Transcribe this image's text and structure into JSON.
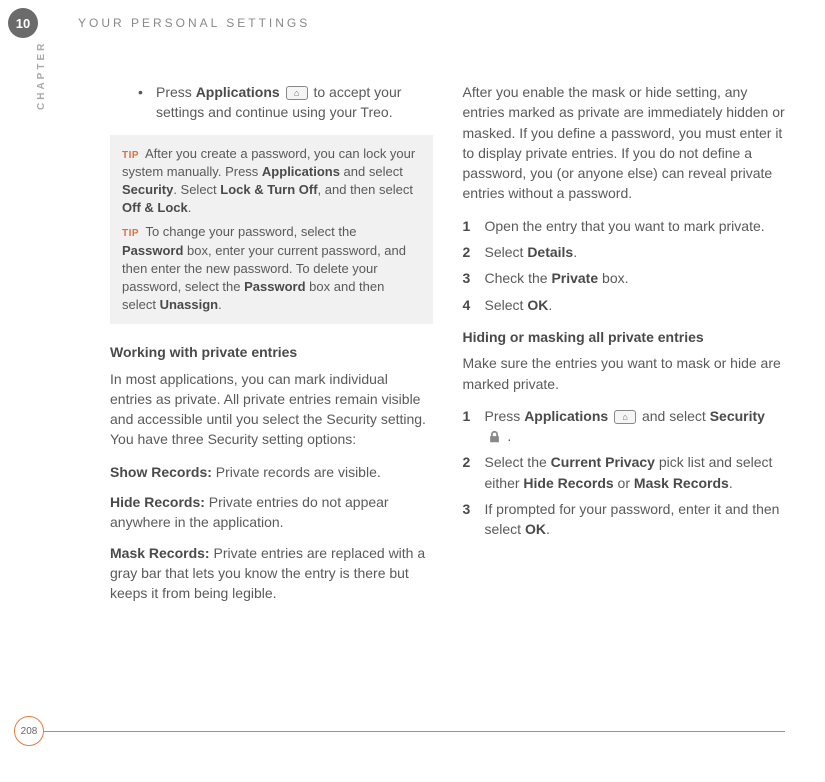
{
  "chapter": {
    "number": "10",
    "label": "CHAPTER",
    "title": "YOUR PERSONAL SETTINGS"
  },
  "page": {
    "number": "208"
  },
  "left": {
    "bullet": {
      "pre": "Press ",
      "b1": "Applications",
      "post": " to accept your settings and continue using your Treo."
    },
    "tip1": {
      "label": "TIP",
      "t1": "After you create a password, you can lock your system manually. Press ",
      "b1": "Applications",
      "t2": " and select ",
      "b2": "Security",
      "t3": ". Select ",
      "b3": "Lock & Turn Off",
      "t4": ", and then select ",
      "b4": "Off & Lock",
      "t5": "."
    },
    "tip2": {
      "label": "TIP",
      "t1": "To change your password, select the ",
      "b1": "Password",
      "t2": " box, enter your current password, and then enter the new password. To delete your password, select the ",
      "b2": "Password",
      "t3": " box and then select ",
      "b3": "Unassign",
      "t4": "."
    },
    "h1": "Working with private entries",
    "p1": "In most applications, you can mark individual entries as private. All private entries remain visible and accessible until you select the Security setting. You have three Security setting options:",
    "d1": {
      "b": "Show Records:",
      "t": " Private records are visible."
    },
    "d2": {
      "b": "Hide Records:",
      "t": " Private entries do not appear anywhere in the application."
    },
    "d3": {
      "b": "Mask Records:",
      "t": " Private entries are replaced with a gray bar that lets you know the entry is there but keeps it from being legible."
    }
  },
  "right": {
    "intro": "After you enable the mask or hide setting, any entries marked as private are immediately hidden or masked. If you define a password, you must enter it to display private entries. If you do not define a password, you (or anyone else) can reveal private entries without a password.",
    "listA": {
      "i1": "Open the entry that you want to mark private.",
      "i2": {
        "t1": "Select ",
        "b1": "Details",
        "t2": "."
      },
      "i3": {
        "t1": "Check the ",
        "b1": "Private",
        "t2": " box."
      },
      "i4": {
        "t1": "Select ",
        "b1": "OK",
        "t2": "."
      }
    },
    "h2": "Hiding or masking all private entries",
    "p2": "Make sure the entries you want to mask or hide are marked private.",
    "listB": {
      "i1": {
        "t1": "Press ",
        "b1": "Applications",
        "t2": " and select ",
        "b2": "Security",
        "t3": " ."
      },
      "i2": {
        "t1": "Select the ",
        "b1": "Current Privacy",
        "t2": " pick list and select either ",
        "b2": "Hide Records",
        "t3": " or ",
        "b3": "Mask Records",
        "t4": "."
      },
      "i3": {
        "t1": "If prompted for your password, enter it and then select ",
        "b1": "OK",
        "t2": "."
      }
    }
  },
  "nums": {
    "n1": "1",
    "n2": "2",
    "n3": "3",
    "n4": "4"
  },
  "bullet_char": "•"
}
